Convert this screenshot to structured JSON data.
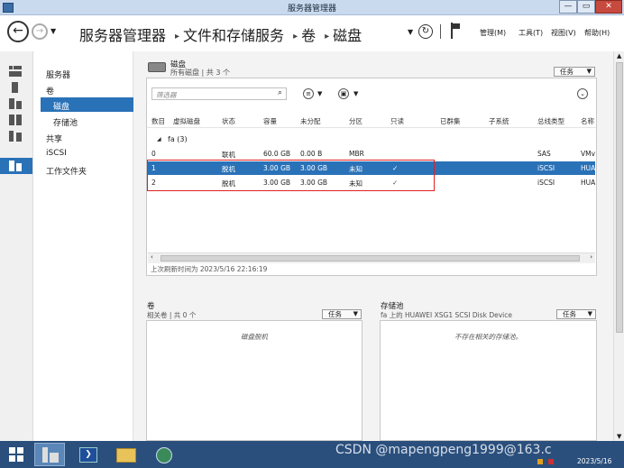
{
  "window": {
    "title": "服务器管理器",
    "buttons": {
      "minimize": "—",
      "restore": "▭",
      "close": "✕"
    }
  },
  "nav": {
    "breadcrumb": [
      "服务器管理器",
      "文件和存储服务",
      "卷",
      "磁盘"
    ],
    "separator": "▸",
    "menu": [
      "管理(M)",
      "工具(T)",
      "视图(V)",
      "帮助(H)"
    ]
  },
  "sidebar": {
    "items": [
      {
        "label": "服务器"
      },
      {
        "label": "卷"
      },
      {
        "label": "磁盘"
      },
      {
        "label": "存储池"
      },
      {
        "label": "共享"
      },
      {
        "label": "iSCSI"
      },
      {
        "label": "工作文件夹"
      }
    ],
    "selected": "磁盘"
  },
  "disks": {
    "title": "磁盘",
    "subtitle": "所有磁盘 | 共 3 个",
    "tasks_label": "任务",
    "filter_placeholder": "筛选器",
    "columns": [
      "数目",
      "虚拟磁盘",
      "状态",
      "容量",
      "未分配",
      "分区",
      "只读",
      "已群集",
      "子系统",
      "总线类型",
      "名称"
    ],
    "group": "fa (3)",
    "rows": [
      {
        "num": "0",
        "virtual": "",
        "status": "联机",
        "capacity": "60.0 GB",
        "unallocated": "0.00 B",
        "partition": "MBR",
        "readonly": "",
        "bus": "SAS",
        "name": "VMv"
      },
      {
        "num": "1",
        "virtual": "",
        "status": "脱机",
        "capacity": "3.00 GB",
        "unallocated": "3.00 GB",
        "partition": "未知",
        "readonly": "✓",
        "bus": "iSCSI",
        "name": "HUA"
      },
      {
        "num": "2",
        "virtual": "",
        "status": "脱机",
        "capacity": "3.00 GB",
        "unallocated": "3.00 GB",
        "partition": "未知",
        "readonly": "✓",
        "bus": "iSCSI",
        "name": "HUA"
      }
    ],
    "refresh_text": "上次刷新时间为 2023/5/16 22:16:19"
  },
  "volumes": {
    "title": "卷",
    "subtitle": "相关卷 | 共 0 个",
    "tasks_label": "任务",
    "empty_text": "磁盘脱机"
  },
  "pools": {
    "title": "存储池",
    "subtitle": "fa 上的 HUAWEI XSG1 SCSI Disk Device",
    "tasks_label": "任务",
    "empty_text": "不存在相关的存储池。"
  },
  "taskbar": {
    "clock_date": "2023/5/16",
    "watermark": "CSDN @mapengpeng1999@163.c"
  },
  "colors": {
    "selection": "#2a72b8",
    "highlight_box": "#e02020",
    "taskbar": "#2b4f7c",
    "titlebar": "#c9d9ee"
  }
}
